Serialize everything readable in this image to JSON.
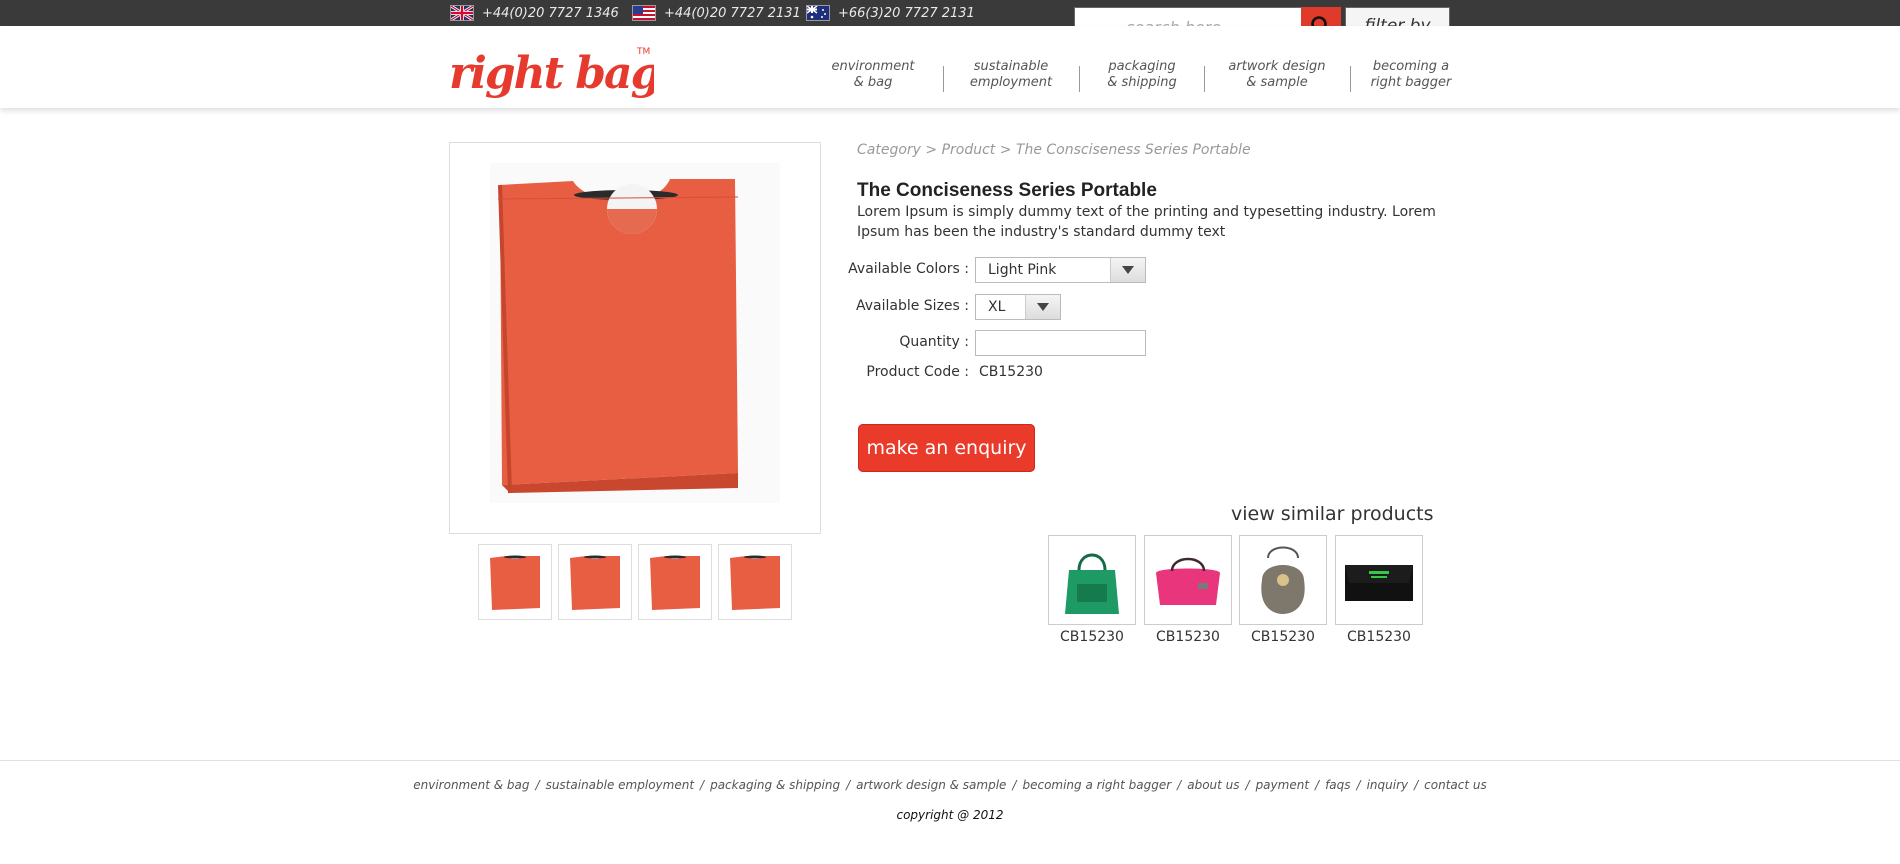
{
  "topbar": {
    "phones": [
      {
        "country": "uk-flag-icon",
        "number": "+44(0)20 7727 1346"
      },
      {
        "country": "us-flag-icon",
        "number": "+44(0)20 7727 2131"
      },
      {
        "country": "au-flag-icon",
        "number": "+66(3)20 7727 2131"
      }
    ],
    "search": {
      "placeholder": "search here . . ."
    },
    "filter_label": "filter by"
  },
  "logo": {
    "text": "right bags",
    "trademark": "TM"
  },
  "nav": [
    {
      "line1": "environment",
      "line2": "& bag"
    },
    {
      "line1": "sustainable",
      "line2": "employment"
    },
    {
      "line1": "packaging",
      "line2": "& shipping"
    },
    {
      "line1": "artwork design",
      "line2": "& sample"
    },
    {
      "line1": "becoming a",
      "line2": "right bagger"
    }
  ],
  "breadcrumb": "Category > Product > The Consciseness Series Portable",
  "product": {
    "title": "The Conciseness Series Portable",
    "description": "Lorem Ipsum is simply dummy text of the printing and typesetting industry. Lorem Ipsum has been the industry's standard dummy text",
    "colors_label": "Available Colors :",
    "color_value": "Light Pink",
    "sizes_label": "Available Sizes :",
    "size_value": "XL",
    "quantity_label": "Quantity :",
    "quantity_value": "",
    "code_label": "Product Code :",
    "code_value": "CB15230",
    "enquiry_label": "make an enquiry"
  },
  "similar": {
    "title": "view similar products",
    "items": [
      {
        "code": "CB15230",
        "color": "#1e9b64"
      },
      {
        "code": "CB15230",
        "color": "#e9357b"
      },
      {
        "code": "CB15230",
        "color": "#7e776b"
      },
      {
        "code": "CB15230",
        "color": "#111111"
      }
    ]
  },
  "footer": {
    "links": [
      "environment & bag",
      "sustainable employment",
      "packaging & shipping",
      "artwork design & sample",
      "becoming a right bagger",
      "about us",
      "payment",
      "faqs",
      "inquiry",
      "contact us"
    ],
    "copyright": "copyright @ 2012"
  },
  "colors": {
    "brand": "#e03a2a",
    "topbar": "#3a3a3a"
  }
}
